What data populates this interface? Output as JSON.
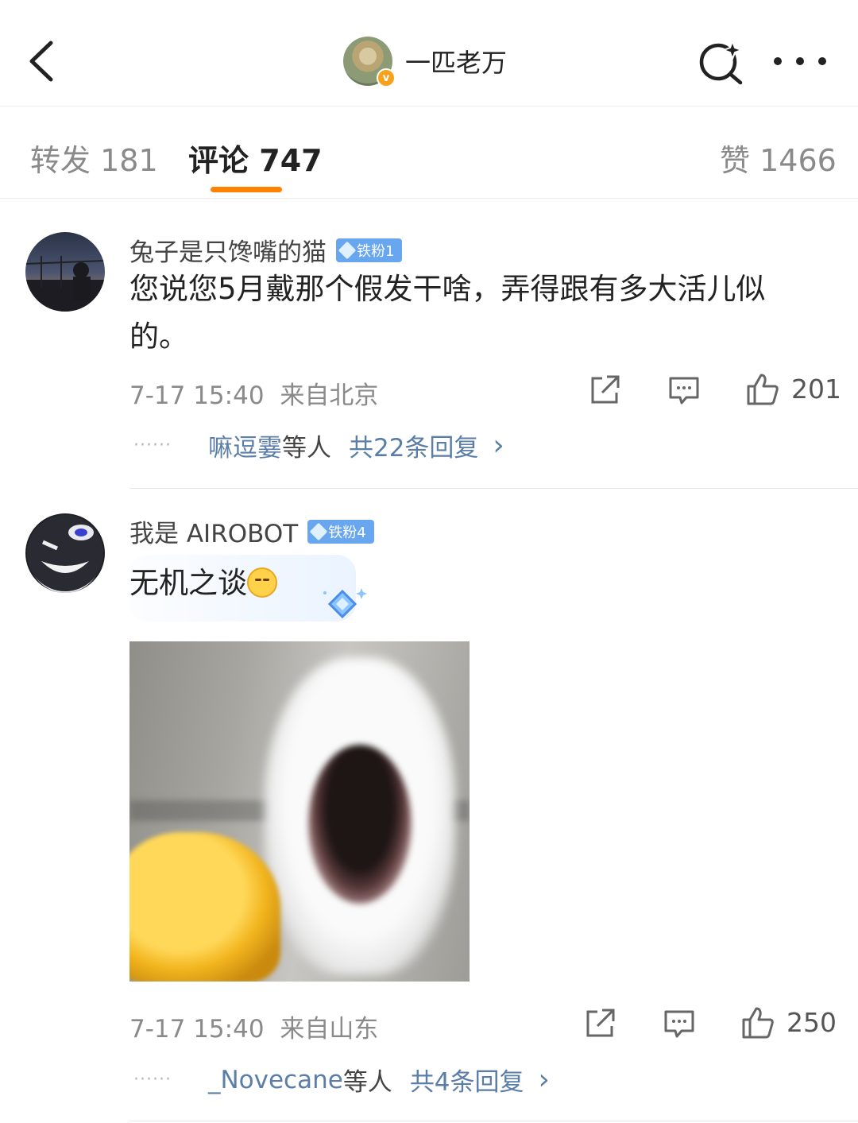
{
  "header": {
    "title": "一匹老万",
    "verified_badge": "v",
    "icons": {
      "back": "chevron-left-icon",
      "search": "search-sparkle-icon",
      "more": "more-horizontal-icon"
    }
  },
  "tabs": [
    {
      "label": "转发",
      "count": "181"
    },
    {
      "label": "评论",
      "count": "747",
      "active": true
    },
    {
      "label": "赞",
      "count": "1466"
    }
  ],
  "colors": {
    "accent": "#ff8200",
    "link": "#5b7ea8",
    "fan_badge": "#68a7ef"
  },
  "comments": [
    {
      "username": "兔子是只馋嘴的猫",
      "fan_badge": "铁粉1",
      "text": "您说您5月戴那个假发干啥，弄得跟有多大活儿似的。",
      "time": "7-17 15:40",
      "location": "来自北京",
      "likes": "201",
      "reply_users": "嘛逗霎",
      "reply_others": "等人",
      "reply_total": "共22条回复",
      "reply_arrow": "›"
    },
    {
      "username": "我是 AIROBOT",
      "fan_badge": "铁粉4",
      "text": "无机之谈",
      "has_image": true,
      "time": "7-17 15:40",
      "location": "来自山东",
      "likes": "250",
      "reply_users": "_Novecane",
      "reply_others": "等人",
      "reply_total": "共4条回复",
      "reply_arrow": "›"
    }
  ]
}
